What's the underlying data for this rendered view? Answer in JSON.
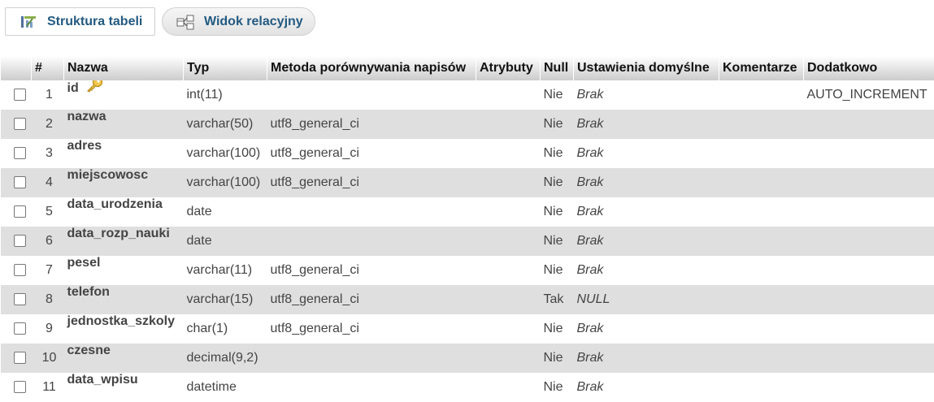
{
  "tabs": [
    {
      "label": "Struktura tabeli",
      "icon": "table-structure-icon"
    },
    {
      "label": "Widok relacyjny",
      "icon": "relation-view-icon"
    }
  ],
  "columns": [
    "#",
    "Nazwa",
    "Typ",
    "Metoda porównywania napisów",
    "Atrybuty",
    "Null",
    "Ustawienia domyślne",
    "Komentarze",
    "Dodatkowo"
  ],
  "rows": [
    {
      "num": "1",
      "name": "id",
      "primary_key": true,
      "type": "int(11)",
      "collation": "",
      "attributes": "",
      "null": "Nie",
      "default": "Brak",
      "comments": "",
      "extra": "AUTO_INCREMENT"
    },
    {
      "num": "2",
      "name": "nazwa",
      "type": "varchar(50)",
      "collation": "utf8_general_ci",
      "attributes": "",
      "null": "Nie",
      "default": "Brak",
      "comments": "",
      "extra": ""
    },
    {
      "num": "3",
      "name": "adres",
      "type": "varchar(100)",
      "collation": "utf8_general_ci",
      "attributes": "",
      "null": "Nie",
      "default": "Brak",
      "comments": "",
      "extra": ""
    },
    {
      "num": "4",
      "name": "miejscowosc",
      "type": "varchar(100)",
      "collation": "utf8_general_ci",
      "attributes": "",
      "null": "Nie",
      "default": "Brak",
      "comments": "",
      "extra": ""
    },
    {
      "num": "5",
      "name": "data_urodzenia",
      "type": "date",
      "collation": "",
      "attributes": "",
      "null": "Nie",
      "default": "Brak",
      "comments": "",
      "extra": ""
    },
    {
      "num": "6",
      "name": "data_rozp_nauki",
      "type": "date",
      "collation": "",
      "attributes": "",
      "null": "Nie",
      "default": "Brak",
      "comments": "",
      "extra": ""
    },
    {
      "num": "7",
      "name": "pesel",
      "type": "varchar(11)",
      "collation": "utf8_general_ci",
      "attributes": "",
      "null": "Nie",
      "default": "Brak",
      "comments": "",
      "extra": ""
    },
    {
      "num": "8",
      "name": "telefon",
      "type": "varchar(15)",
      "collation": "utf8_general_ci",
      "attributes": "",
      "null": "Tak",
      "default": "NULL",
      "comments": "",
      "extra": ""
    },
    {
      "num": "9",
      "name": "jednostka_szkoly",
      "type": "char(1)",
      "collation": "utf8_general_ci",
      "attributes": "",
      "null": "Nie",
      "default": "Brak",
      "comments": "",
      "extra": ""
    },
    {
      "num": "10",
      "name": "czesne",
      "type": "decimal(9,2)",
      "collation": "",
      "attributes": "",
      "null": "Nie",
      "default": "Brak",
      "comments": "",
      "extra": ""
    },
    {
      "num": "11",
      "name": "data_wpisu",
      "type": "datetime",
      "collation": "",
      "attributes": "",
      "null": "Nie",
      "default": "Brak",
      "comments": "",
      "extra": ""
    }
  ],
  "colors": {
    "link": "#235a81",
    "row_alt": "#dfdfdf",
    "key_icon": "#e0b33a"
  }
}
